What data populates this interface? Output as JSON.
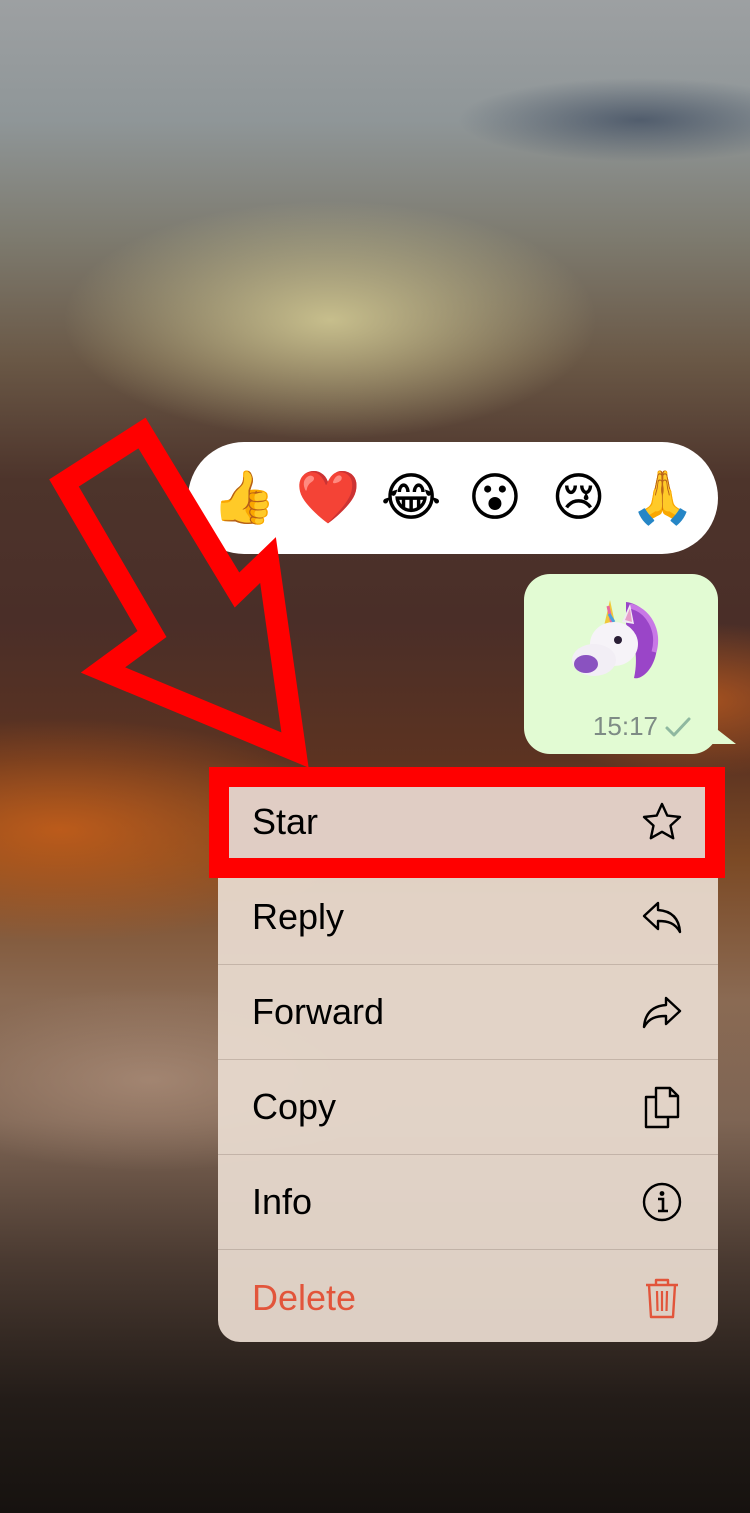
{
  "reactions": [
    "👍",
    "❤️",
    "😂",
    "😮",
    "😢",
    "🙏"
  ],
  "message": {
    "sticker": "unicorn-sticker",
    "time": "15:17",
    "status": "sent-check-icon"
  },
  "menu": {
    "items": [
      {
        "label": "Star",
        "icon": "star-icon"
      },
      {
        "label": "Reply",
        "icon": "reply-icon"
      },
      {
        "label": "Forward",
        "icon": "forward-icon"
      },
      {
        "label": "Copy",
        "icon": "copy-icon"
      },
      {
        "label": "Info",
        "icon": "info-icon"
      },
      {
        "label": "Delete",
        "icon": "trash-icon"
      }
    ]
  },
  "colors": {
    "bubble": "#e2fbd3",
    "annotation": "#ff0000",
    "destructive": "#e2553b"
  }
}
